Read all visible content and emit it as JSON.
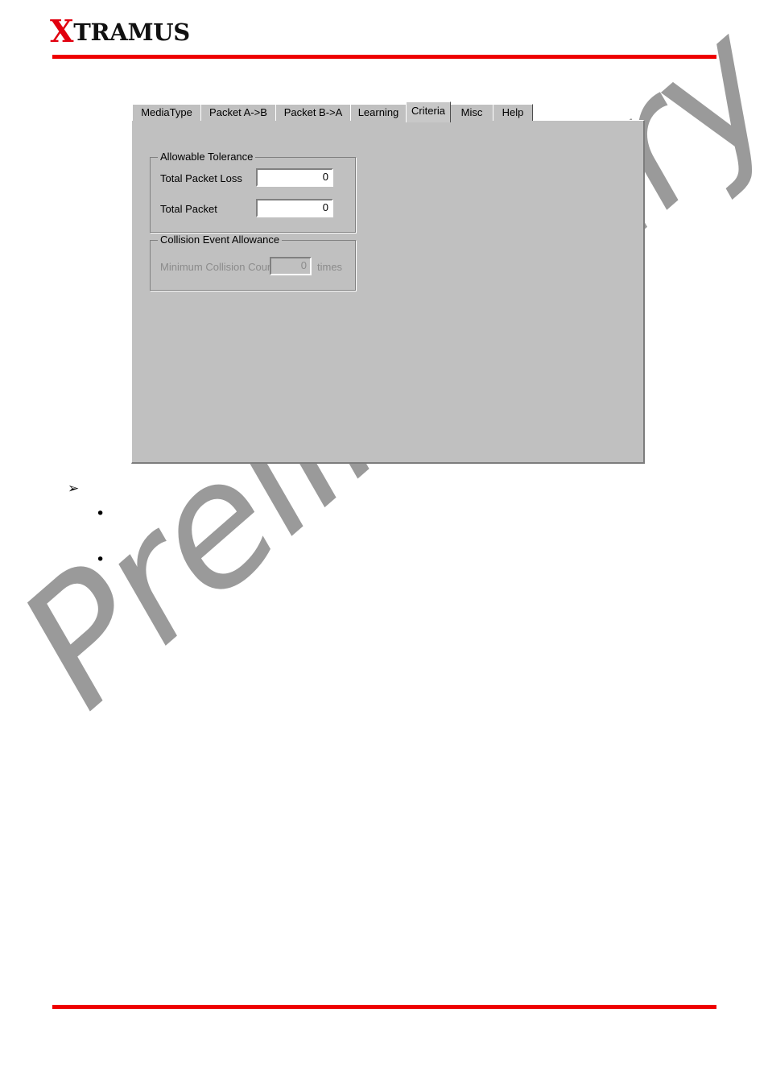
{
  "header": {
    "logo_x": "X",
    "logo_rest": "TRAMUS"
  },
  "watermark": {
    "text": "Preliminary",
    "color": "#9a9a9a"
  },
  "dialog": {
    "tabs": [
      {
        "label": "MediaType",
        "selected": false
      },
      {
        "label": "Packet A->B",
        "selected": false
      },
      {
        "label": "Packet B->A",
        "selected": false
      },
      {
        "label": "Learning",
        "selected": false
      },
      {
        "label": "Criteria",
        "selected": true
      },
      {
        "label": "Misc",
        "selected": false
      },
      {
        "label": "Help",
        "selected": false
      }
    ],
    "groups": {
      "allowable_tolerance": {
        "title": "Allowable Tolerance",
        "fields": [
          {
            "label": "Total Packet Loss",
            "value": "0",
            "enabled": true
          },
          {
            "label": "Total Packet",
            "value": "0",
            "enabled": true
          }
        ]
      },
      "collision_event_allowance": {
        "title": "Collision Event Allowance",
        "fields": [
          {
            "label": "Minimum Collision Count",
            "value": "0",
            "unit": "times",
            "enabled": false
          }
        ]
      }
    },
    "background_color": "#c0c0c0"
  },
  "body_markers": {
    "arrow": "➢",
    "bullet_1": "•",
    "bullet_2": "•"
  },
  "rules": {
    "color": "#ee0000"
  }
}
